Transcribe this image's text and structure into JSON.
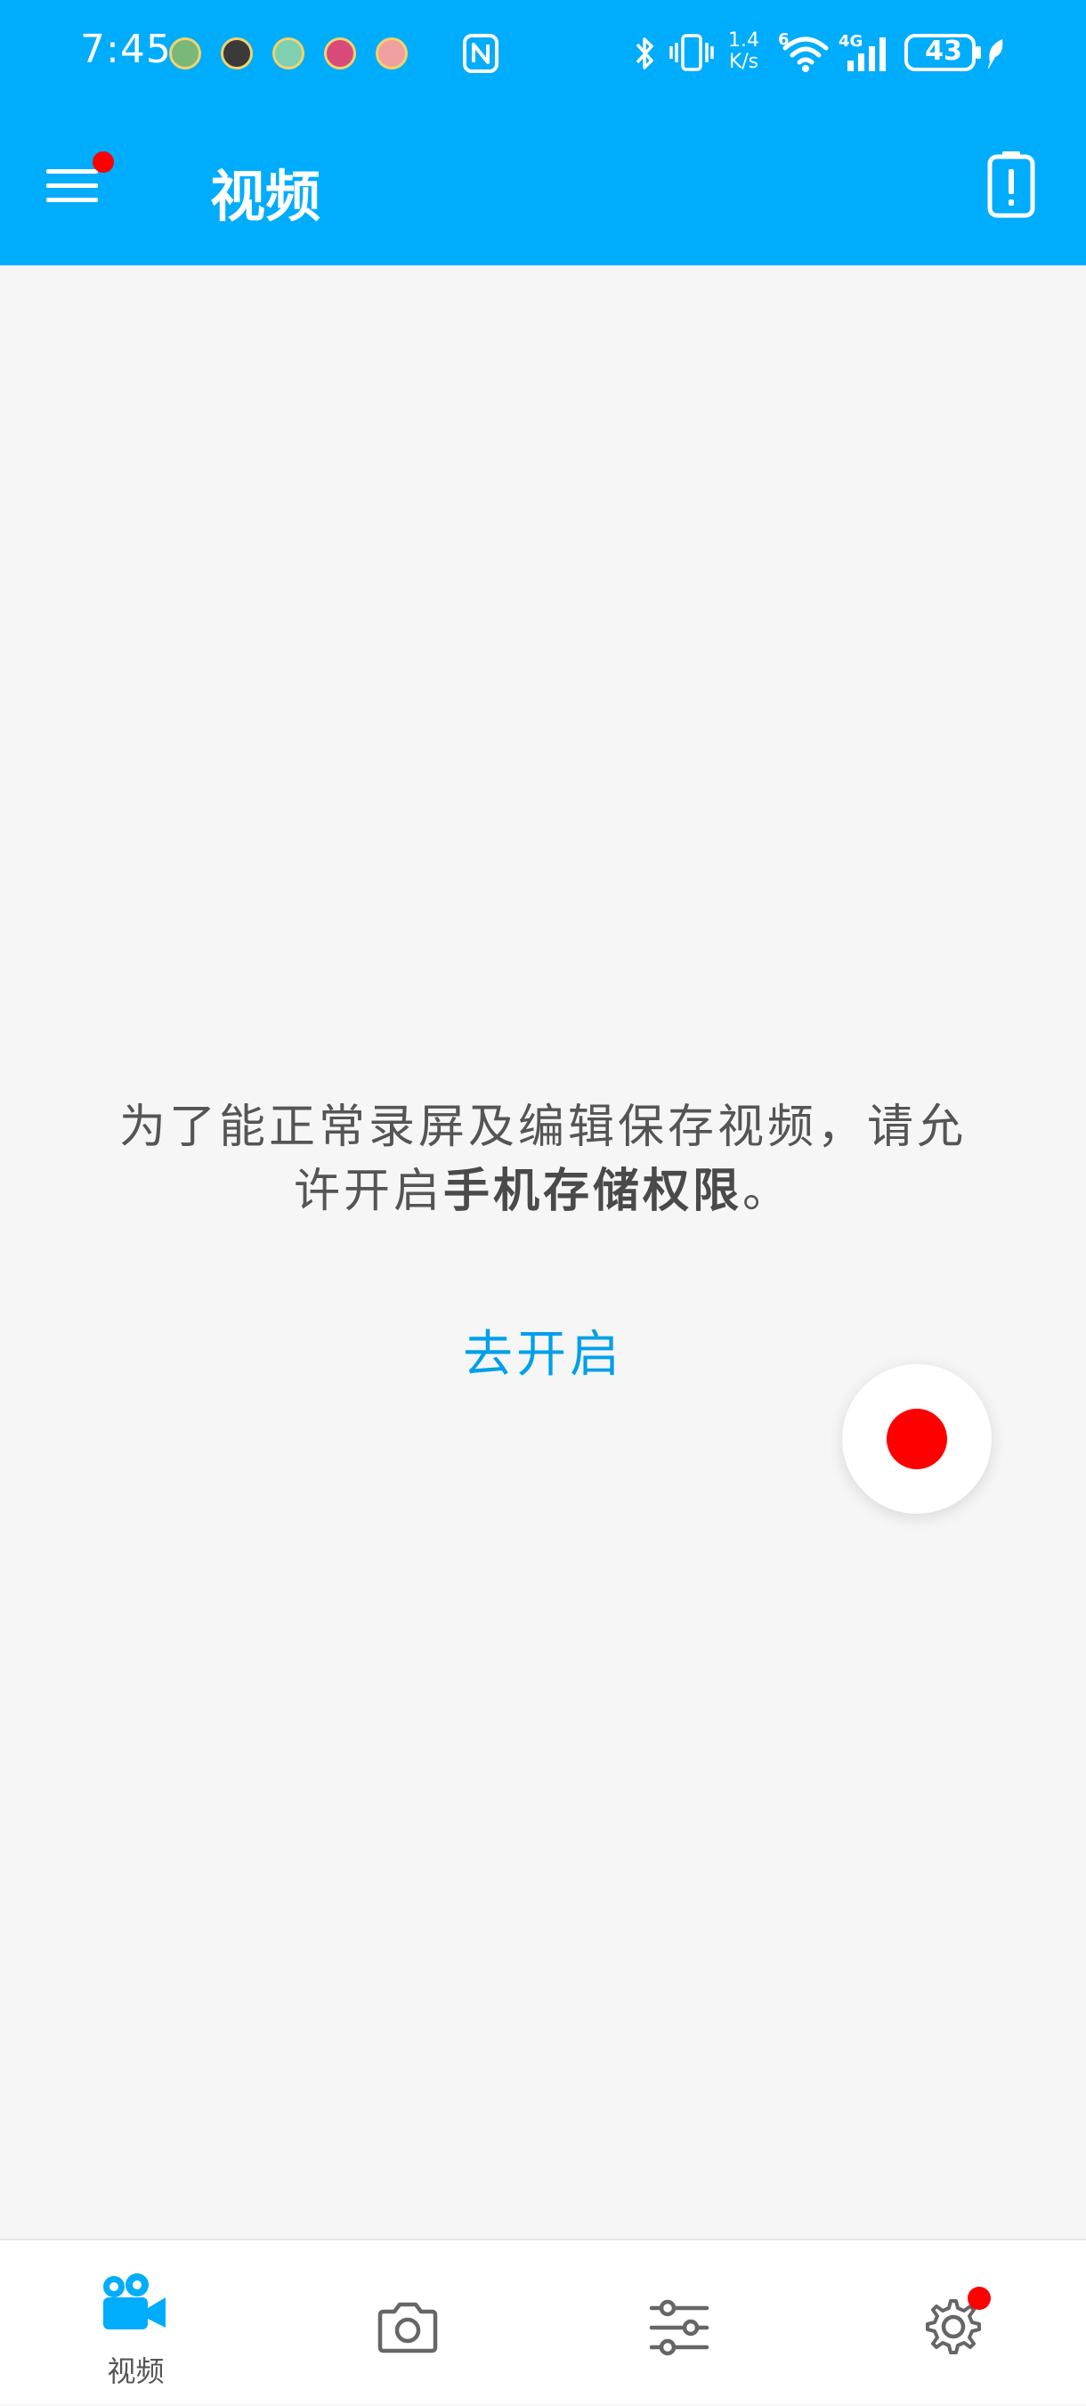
{
  "status_bar": {
    "time": "7:45",
    "network_speed_value": "1.4",
    "network_speed_unit": "K/s",
    "wifi_label": "6",
    "cellular_label": "4G",
    "battery_level": "43"
  },
  "app_bar": {
    "title": "视频"
  },
  "main": {
    "permission_message_part1": "为了能正常录屏及编辑保存视频，请允许开启",
    "permission_message_emphasis": "手机存储权限",
    "permission_message_end": "。",
    "enable_link": "去开启"
  },
  "bottom_nav": {
    "items": [
      {
        "label": "视频",
        "icon": "video-camera-icon",
        "active": true
      },
      {
        "label": "",
        "icon": "camera-icon",
        "active": false
      },
      {
        "label": "",
        "icon": "sliders-icon",
        "active": false
      },
      {
        "label": "",
        "icon": "gear-icon",
        "active": false
      }
    ]
  },
  "colors": {
    "primary": "#00acfc",
    "accent_link": "#00a0e9",
    "record": "#ff0000",
    "background": "#f6f6f6"
  }
}
